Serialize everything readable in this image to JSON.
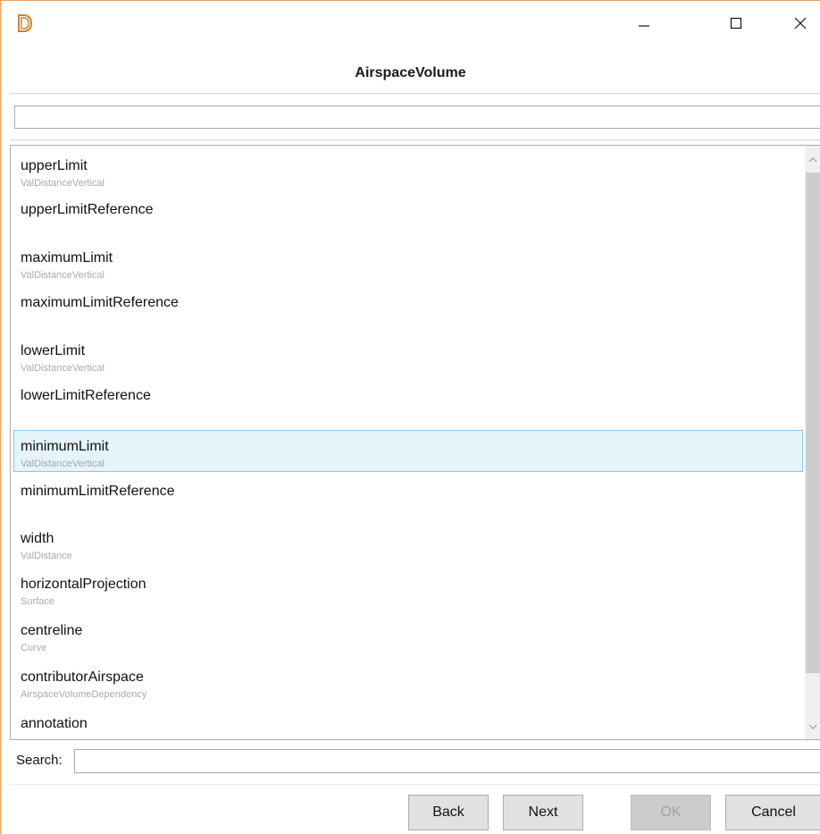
{
  "window": {
    "title": "AirspaceVolume",
    "icon": "d-logo-icon"
  },
  "filter_input": {
    "value": "",
    "placeholder": ""
  },
  "list": {
    "items": [
      {
        "name": "upperLimit",
        "type": "ValDistanceVertical"
      },
      {
        "name": "upperLimitReference",
        "type": ""
      },
      {
        "name": "maximumLimit",
        "type": "ValDistanceVertical"
      },
      {
        "name": "maximumLimitReference",
        "type": ""
      },
      {
        "name": "lowerLimit",
        "type": "ValDistanceVertical"
      },
      {
        "name": "lowerLimitReference",
        "type": ""
      },
      {
        "name": "minimumLimit",
        "type": "ValDistanceVertical",
        "selected": true
      },
      {
        "name": "minimumLimitReference",
        "type": ""
      },
      {
        "name": "width",
        "type": "ValDistance"
      },
      {
        "name": "horizontalProjection",
        "type": "Surface"
      },
      {
        "name": "centreline",
        "type": "Curve"
      },
      {
        "name": "contributorAirspace",
        "type": "AirspaceVolumeDependency"
      },
      {
        "name": "annotation",
        "type": ""
      }
    ]
  },
  "search": {
    "label": "Search:",
    "value": ""
  },
  "buttons": {
    "back": "Back",
    "next": "Next",
    "ok": "OK",
    "cancel": "Cancel"
  },
  "colors": {
    "accent_border": "#e8a062",
    "selection_bg": "#e5f3fb",
    "selection_border": "#8ac5e8",
    "type_text": "#a9a9a9"
  }
}
